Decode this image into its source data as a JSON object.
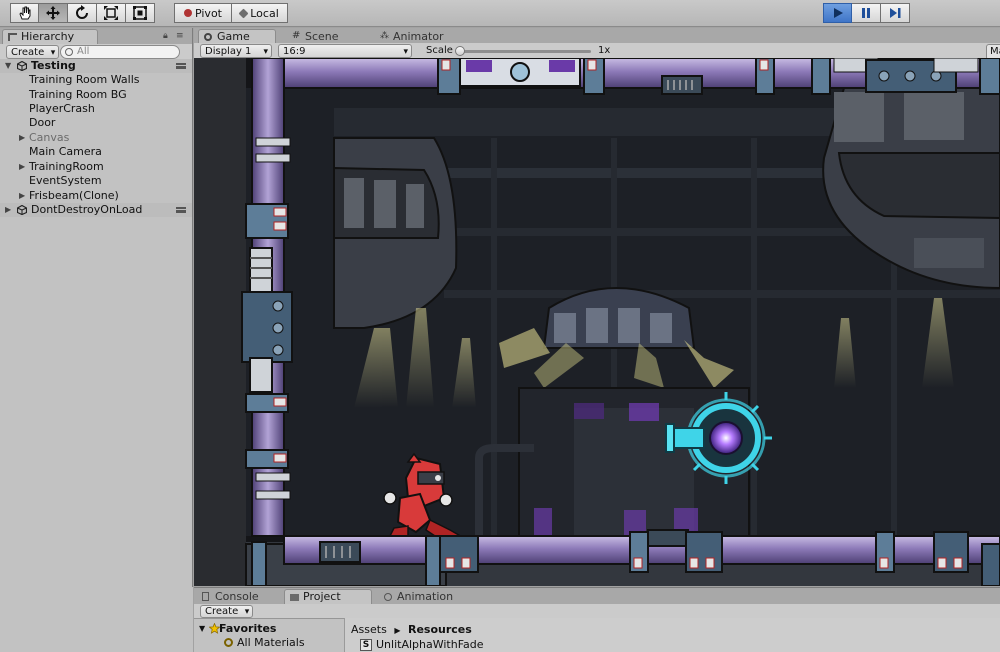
{
  "toolbar": {
    "tools": [
      {
        "icon": "hand-icon"
      },
      {
        "icon": "move-icon"
      },
      {
        "icon": "rotate-icon"
      },
      {
        "icon": "scale-icon"
      },
      {
        "icon": "rect-icon"
      }
    ],
    "pivot_label": "Pivot",
    "local_label": "Local",
    "play_controls": [
      {
        "icon": "play-icon",
        "active": true
      },
      {
        "icon": "pause-icon",
        "active": false
      },
      {
        "icon": "step-icon",
        "active": false
      }
    ]
  },
  "hierarchy": {
    "tab_label": "Hierarchy",
    "create_label": "Create",
    "search_placeholder": "All",
    "scenes": [
      {
        "name": "Testing",
        "children": [
          {
            "label": "Training Room Walls",
            "expandable": false,
            "inactive": false
          },
          {
            "label": "Training Room BG",
            "expandable": false,
            "inactive": false
          },
          {
            "label": "PlayerCrash",
            "expandable": false,
            "inactive": false
          },
          {
            "label": "Door",
            "expandable": false,
            "inactive": false
          },
          {
            "label": "Canvas",
            "expandable": true,
            "inactive": true
          },
          {
            "label": "Main Camera",
            "expandable": false,
            "inactive": false
          },
          {
            "label": "TrainingRoom",
            "expandable": true,
            "inactive": false
          },
          {
            "label": "EventSystem",
            "expandable": false,
            "inactive": false
          },
          {
            "label": "Frisbeam(Clone)",
            "expandable": true,
            "inactive": false
          }
        ]
      },
      {
        "name": "DontDestroyOnLoad",
        "children": []
      }
    ]
  },
  "editor_tabs": {
    "game": "Game",
    "scene": "Scene",
    "animator": "Animator"
  },
  "game_view": {
    "display": "Display 1",
    "aspect": "16:9",
    "scale_label": "Scale",
    "scale_value": "1x",
    "maximize_label": "Ma"
  },
  "bottom_panel": {
    "tabs": {
      "console": "Console",
      "project": "Project",
      "animation": "Animation"
    },
    "create_label": "Create",
    "favorites_title": "Favorites",
    "favorites_items": [
      "All Materials"
    ],
    "breadcrumb": {
      "root": "Assets",
      "current": "Resources"
    },
    "files": [
      {
        "name": "UnlitAlphaWithFade",
        "icon": "shader-file-icon"
      }
    ]
  },
  "colors": {
    "play_active": "#3f75c8",
    "pipe_purple": "#8d7ab8",
    "glow_cyan": "#3fd4e8",
    "robot_red": "#d83a3a"
  }
}
